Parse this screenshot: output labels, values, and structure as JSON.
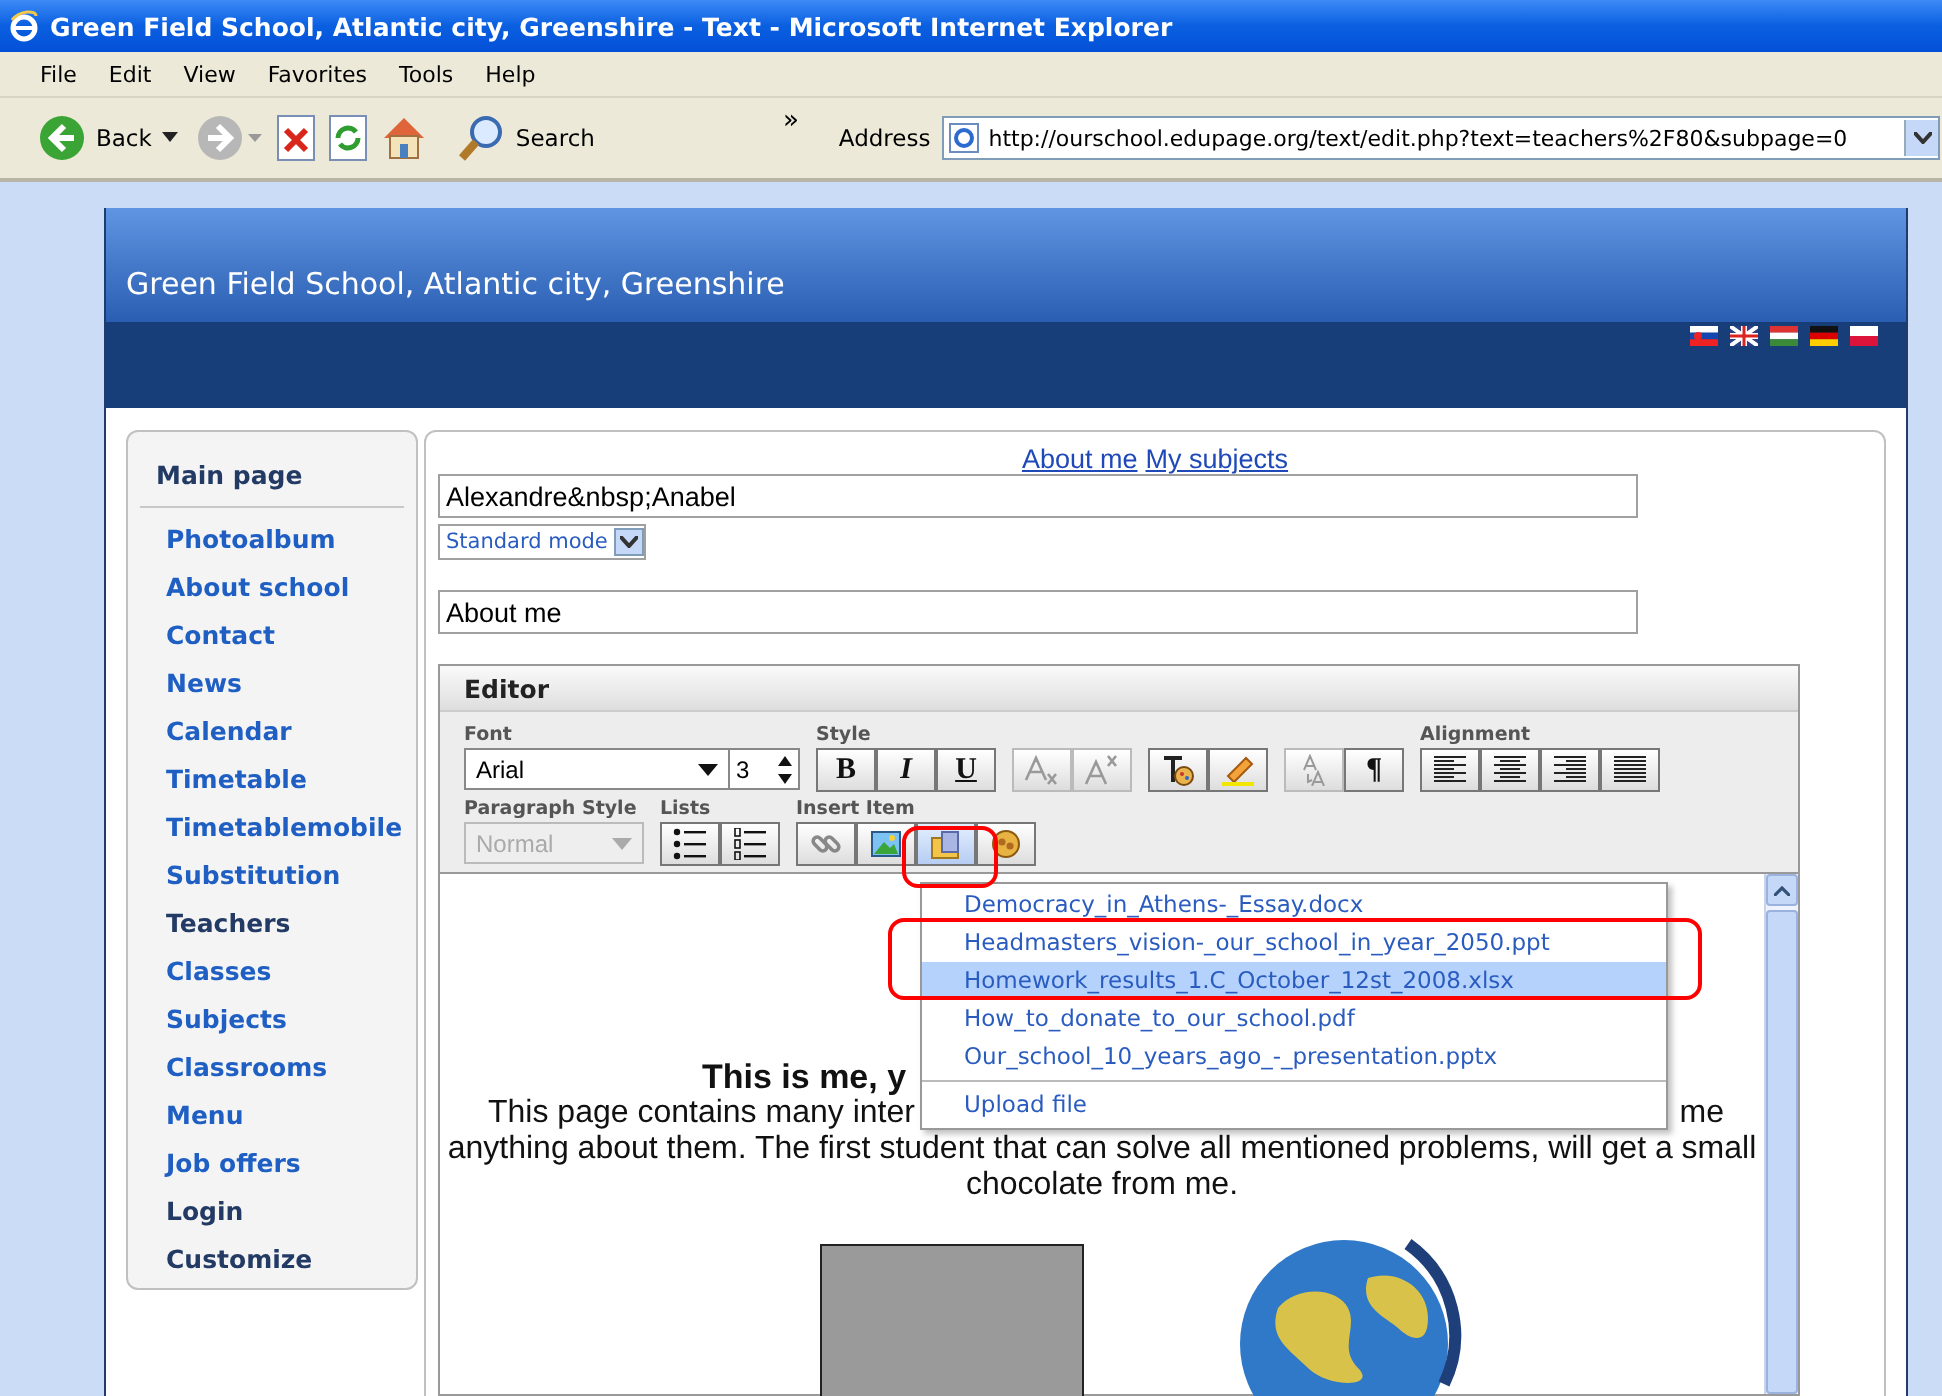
{
  "window": {
    "title": "Green Field School, Atlantic city, Greenshire - Text - Microsoft Internet Explorer"
  },
  "menu_bar": [
    "File",
    "Edit",
    "View",
    "Favorites",
    "Tools",
    "Help"
  ],
  "toolbar": {
    "back": "Back",
    "search": "Search",
    "overflow": "»",
    "address_label": "Address",
    "address": "http://ourschool.edupage.org/text/edit.php?text=teachers%2F80&subpage=0"
  },
  "site": {
    "title": "Green Field School, Atlantic city, Greenshire"
  },
  "sidebar": {
    "items": [
      {
        "label": "Main page",
        "kind": "home"
      },
      {
        "label": "Photoalbum",
        "kind": "link"
      },
      {
        "label": "About school",
        "kind": "link"
      },
      {
        "label": "Contact",
        "kind": "link"
      },
      {
        "label": "News",
        "kind": "link"
      },
      {
        "label": "Calendar",
        "kind": "link"
      },
      {
        "label": "Timetable",
        "kind": "link"
      },
      {
        "label": "Timetablemobile",
        "kind": "link"
      },
      {
        "label": "Substitution",
        "kind": "link"
      },
      {
        "label": "Teachers",
        "kind": "current"
      },
      {
        "label": "Classes",
        "kind": "link"
      },
      {
        "label": "Subjects",
        "kind": "link"
      },
      {
        "label": "Classrooms",
        "kind": "link"
      },
      {
        "label": "Menu",
        "kind": "link"
      },
      {
        "label": "Job offers",
        "kind": "link"
      },
      {
        "label": "Login",
        "kind": "account"
      },
      {
        "label": "Customize",
        "kind": "account"
      }
    ]
  },
  "page_links": [
    "About me",
    "My subjects"
  ],
  "form": {
    "name_value": "Alexandre&nbsp;Anabel",
    "mode": "Standard mode",
    "page_title_value": "About me"
  },
  "editor": {
    "title": "Editor",
    "format_groups": [
      {
        "label": "Font",
        "controls": [
          {
            "kind": "select",
            "value": "Arial",
            "disabled": false
          },
          {
            "kind": "spinner",
            "value": "3",
            "disabled": false
          }
        ]
      },
      {
        "label": "Style",
        "controls": [
          {
            "kind": "bold",
            "text": "B",
            "disabled": false,
            "pressed": false
          },
          {
            "kind": "italic",
            "text": "I",
            "disabled": false,
            "pressed": false
          },
          {
            "kind": "underline",
            "text": "U",
            "disabled": false,
            "pressed": false
          }
        ]
      },
      {
        "controls": [
          {
            "kind": "subscript",
            "disabled": true,
            "pressed": false
          },
          {
            "kind": "superscript",
            "disabled": true,
            "pressed": false
          }
        ]
      },
      {
        "controls": [
          {
            "kind": "text-color",
            "disabled": false,
            "pressed": false
          },
          {
            "kind": "highlight",
            "disabled": false,
            "pressed": false
          }
        ]
      },
      {
        "controls": [
          {
            "kind": "font-size",
            "disabled": true,
            "pressed": false
          },
          {
            "kind": "paragraph",
            "text": "¶",
            "disabled": false,
            "pressed": false
          }
        ]
      },
      {
        "label": "Alignment",
        "controls": [
          {
            "kind": "align-left",
            "disabled": false,
            "pressed": false
          },
          {
            "kind": "align-center",
            "disabled": false,
            "pressed": false
          },
          {
            "kind": "align-right",
            "disabled": false,
            "pressed": false
          },
          {
            "kind": "align-justify",
            "disabled": false,
            "pressed": false
          }
        ]
      }
    ],
    "insert_groups": [
      {
        "label": "Paragraph Style",
        "controls": [
          {
            "kind": "select",
            "value": "Normal",
            "disabled": true
          }
        ]
      },
      {
        "label": "Lists",
        "controls": [
          {
            "kind": "bullets",
            "disabled": false,
            "pressed": false
          },
          {
            "kind": "numbers",
            "disabled": false,
            "pressed": false
          }
        ]
      },
      {
        "label": "Insert Item",
        "controls": [
          {
            "kind": "link",
            "disabled": false,
            "pressed": false
          },
          {
            "kind": "image",
            "disabled": false,
            "pressed": false
          },
          {
            "kind": "file",
            "disabled": false,
            "pressed": true
          },
          {
            "kind": "plugin",
            "disabled": false,
            "pressed": false
          }
        ]
      }
    ]
  },
  "content": {
    "heading": "This is me, y",
    "line_1_start": "This page contains many inter",
    "line_1_end": "me",
    "lines": [
      "anything about them. The first student that can solve all mentioned problems, will get a small",
      "chocolate from me."
    ]
  },
  "file_menu": {
    "items": [
      {
        "label": "Democracy_in_Athens-_Essay.docx",
        "selected": false
      },
      {
        "label": "Headmasters_vision-_our_school_in_year_2050.ppt",
        "selected": false
      },
      {
        "label": "Homework_results_1.C_October_12st_2008.xlsx",
        "selected": true
      },
      {
        "label": "How_to_donate_to_our_school.pdf",
        "selected": false
      },
      {
        "label": "Our_school_10_years_ago_-_presentation.pptx",
        "selected": false
      }
    ],
    "action": "Upload file"
  }
}
